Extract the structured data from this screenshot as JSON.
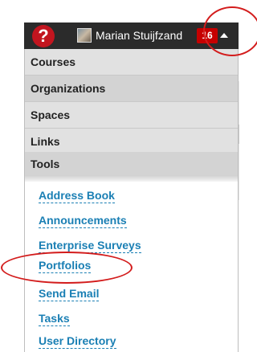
{
  "header": {
    "help_glyph": "?",
    "user_name": "Marian Stuijfzand",
    "notification_count": "16"
  },
  "menu": {
    "categories": [
      "Courses",
      "Organizations",
      "Spaces",
      "Links",
      "Tools"
    ],
    "tools": [
      "Address Book",
      "Announcements",
      "Enterprise Surveys",
      "Portfolios",
      "Send Email",
      "Tasks",
      "User Directory"
    ]
  },
  "colors": {
    "topbar": "#2b2b2b",
    "badge": "#c60000",
    "link": "#1a7fb4",
    "annotation": "#d31c1c"
  }
}
